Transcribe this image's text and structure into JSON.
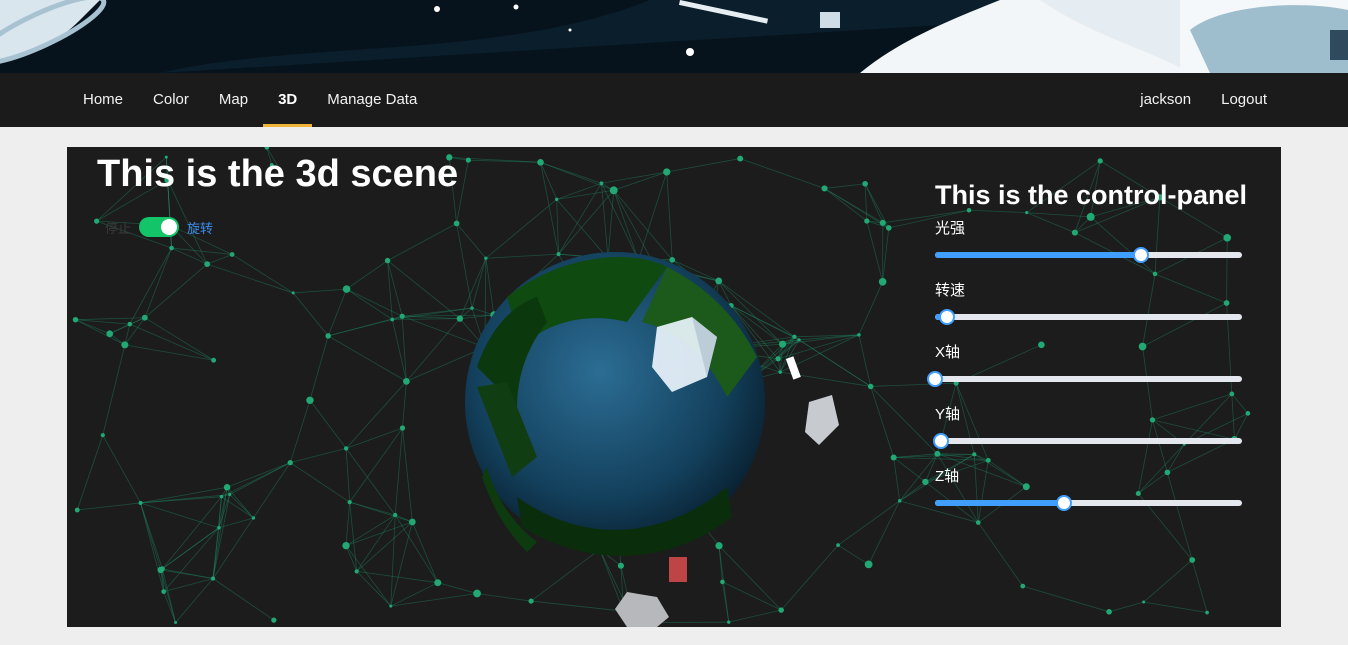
{
  "nav": {
    "left": [
      {
        "label": "Home",
        "active": false
      },
      {
        "label": "Color",
        "active": false
      },
      {
        "label": "Map",
        "active": false
      },
      {
        "label": "3D",
        "active": true
      },
      {
        "label": "Manage Data",
        "active": false
      }
    ],
    "user": "jackson",
    "logout": "Logout",
    "accent_color": "#f0b43a"
  },
  "scene": {
    "title": "This is the 3d scene",
    "toggle": {
      "off_label": "停止",
      "on_label": "旋转",
      "on": true
    }
  },
  "panel": {
    "title": "This is the control-panel",
    "sliders": [
      {
        "label": "光强",
        "value": 0.67
      },
      {
        "label": "转速",
        "value": 0.04
      },
      {
        "label": "X轴",
        "value": 0.0
      },
      {
        "label": "Y轴",
        "value": 0.02
      },
      {
        "label": "Z轴",
        "value": 0.42
      }
    ],
    "slider_color": "#409eff"
  }
}
